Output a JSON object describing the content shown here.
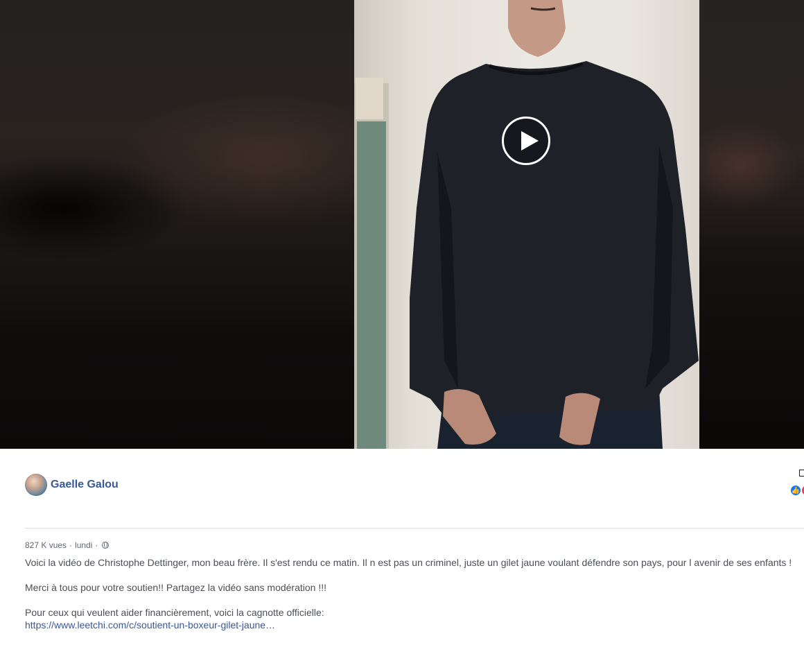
{
  "video": {
    "play_icon": "play-icon"
  },
  "post": {
    "author": "Gaelle Galou",
    "meta": {
      "views": "827 K vues",
      "separator": "·",
      "date": "lundi",
      "privacy_icon": "globe-icon"
    },
    "text_line_1": "Voici la vidéo de Christophe Dettinger, mon beau frère. Il s'est rendu ce matin. Il n est pas un criminel, juste un gilet jaune voulant défendre son pays, pour l avenir de ses enfants !",
    "text_line_2": "Merci à tous pour votre soutien!! Partagez la vidéo sans modération !!!",
    "text_line_3": "Pour ceux qui veulent aider financièrement, voici la cagnotte officielle:",
    "link": "https://www.leetchi.com/c/soutient-un-boxeur-gilet-jaune…"
  },
  "reactions": {
    "icons": [
      "like-icon",
      "love-icon"
    ],
    "like_color": "#1877f2",
    "love_color": "#f33e58"
  },
  "colors": {
    "link_blue": "#385898",
    "text": "#4b4f56",
    "meta": "#606770"
  }
}
